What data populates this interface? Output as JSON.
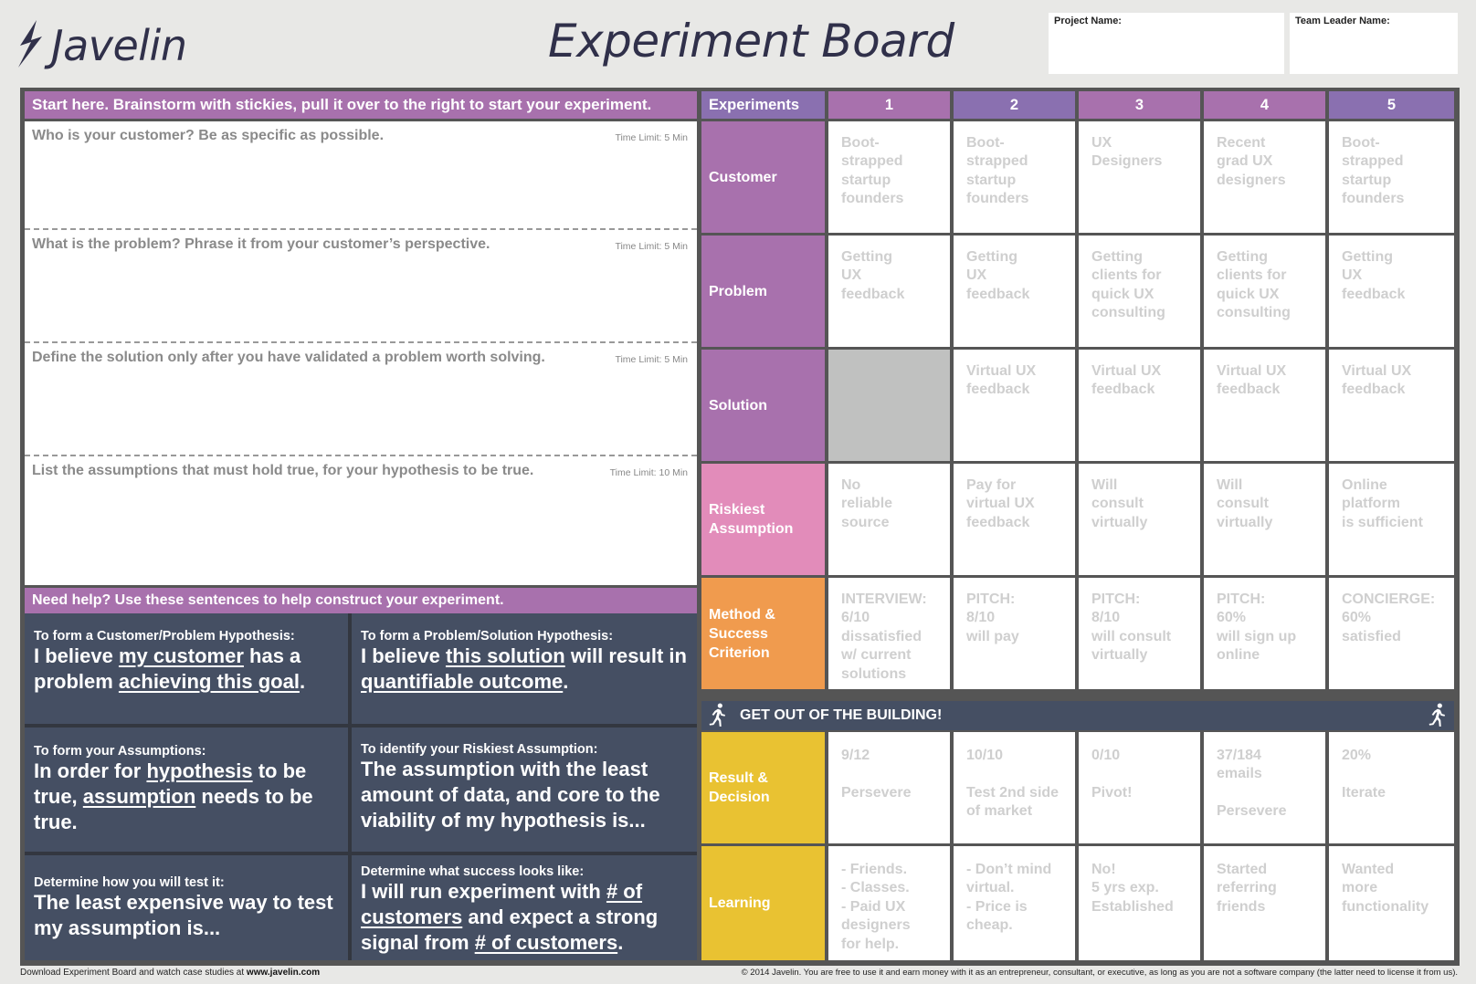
{
  "header": {
    "logo_text": "Javelin",
    "title": "Experiment Board",
    "project_name_label": "Project Name:",
    "project_name_value": "",
    "team_leader_label": "Team Leader Name:",
    "team_leader_value": ""
  },
  "brainstorm": {
    "heading": "Start here. Brainstorm with stickies, pull it over to the right to start your experiment.",
    "sections": [
      {
        "question": "Who is your customer? Be as specific as possible.",
        "time_limit": "Time Limit: 5 Min"
      },
      {
        "question": "What is the problem? Phrase it from your customer’s perspective.",
        "time_limit": "Time Limit: 5 Min"
      },
      {
        "question": "Define the solution only after you have validated a problem worth solving.",
        "time_limit": "Time Limit: 5 Min"
      },
      {
        "question": "List the assumptions that must hold true, for your hypothesis to be true.",
        "time_limit": "Time Limit: 10 Min"
      }
    ]
  },
  "help": {
    "heading": "Need help? Use these sentences to help construct your experiment.",
    "cells": [
      {
        "label": "To form a Customer/Problem Hypothesis:",
        "parts": [
          "I believe ",
          "my customer",
          " has a problem ",
          "achieving this goal",
          "."
        ]
      },
      {
        "label": "To form a Problem/Solution Hypothesis:",
        "parts": [
          "I believe ",
          "this solution",
          " will result in ",
          "quantifiable outcome",
          "."
        ]
      },
      {
        "label": "To form your Assumptions:",
        "parts": [
          "In order for ",
          "hypothesis",
          " to be true, ",
          "assumption",
          " needs to be true."
        ]
      },
      {
        "label": "To identify your Riskiest Assumption:",
        "parts": [
          "The assumption with the least amount of data, and core to the viability of my hypothesis is..."
        ]
      },
      {
        "label": "Determine how you will test it:",
        "parts": [
          "The least expensive way to test my assumption is..."
        ]
      },
      {
        "label": "Determine what success looks like:",
        "parts": [
          "I will run experiment with ",
          "# of customers",
          " and expect a strong signal from ",
          "# of customers",
          "."
        ]
      }
    ]
  },
  "experiments": {
    "header_label": "Experiments",
    "columns": [
      "1",
      "2",
      "3",
      "4",
      "5"
    ],
    "get_out_banner": "GET OUT OF THE BUILDING!",
    "rows": [
      {
        "label": "Customer",
        "color": "#a871ad",
        "cells": [
          "Boot-\nstrapped\nstartup\nfounders",
          "Boot-\nstrapped\nstartup\nfounders",
          "UX\nDesigners",
          "Recent\ngrad UX\ndesigners",
          "Boot-\nstrapped\nstartup\nfounders"
        ]
      },
      {
        "label": "Problem",
        "color": "#a871ad",
        "cells": [
          "Getting\nUX\nfeedback",
          "Getting\nUX\nfeedback",
          "Getting\nclients for\nquick UX\nconsulting",
          "Getting\nclients for\nquick UX\nconsulting",
          "Getting\nUX\nfeedback"
        ]
      },
      {
        "label": "Solution",
        "color": "#a871ad",
        "cells": [
          "",
          "Virtual UX\nfeedback",
          "Virtual UX\nfeedback",
          "Virtual UX\nfeedback",
          "Virtual UX\nfeedback"
        ]
      },
      {
        "label": "Riskiest\nAssumption",
        "color": "#e28cba",
        "cells": [
          "No\nreliable\nsource",
          "Pay for\nvirtual UX\nfeedback",
          "Will\nconsult\nvirtually",
          "Will\nconsult\nvirtually",
          "Online\nplatform\nis sufficient"
        ]
      },
      {
        "label": "Method &\nSuccess\nCriterion",
        "color": "#f09b4e",
        "cells": [
          "INTERVIEW:\n6/10\ndissatisfied\nw/ current\nsolutions",
          "PITCH:\n8/10\nwill pay",
          "PITCH:\n8/10\nwill consult\nvirtually",
          "PITCH:\n60%\nwill sign up\nonline",
          "CONCIERGE:\n60%\nsatisfied"
        ]
      },
      {
        "label": "Result &\nDecision",
        "color": "#e9c232",
        "cells": [
          "9/12\n\nPersevere",
          "10/10\n\nTest 2nd side\nof market",
          "0/10\n\nPivot!",
          "37/184\nemails\n\nPersevere",
          "20%\n\nIterate"
        ]
      },
      {
        "label": "Learning",
        "color": "#e9c232",
        "cells": [
          "- Friends.\n- Classes.\n- Paid UX\n  designers\n  for help.",
          "- Don’t mind\n  virtual.\n- Price is\n  cheap.",
          "No!\n5 yrs exp.\nEstablished",
          "Started\nreferring\nfriends",
          "Wanted\nmore\nfunctionality"
        ]
      }
    ]
  },
  "colors": {
    "purple_pink": "#a871ad",
    "purple_blue": "#8a70b0",
    "navy": "#454f63",
    "frame": "#555555",
    "pink": "#e28cba",
    "orange": "#f09b4e",
    "yellow": "#e9c232"
  },
  "footer": {
    "left_text": "Download Experiment Board and watch case studies at ",
    "left_link": "www.javelin.com",
    "right_text": "© 2014 Javelin. You are free to use it and earn money with it as an entrepreneur, consultant, or executive, as long as you are not a software company (the latter need to license it from us)."
  }
}
